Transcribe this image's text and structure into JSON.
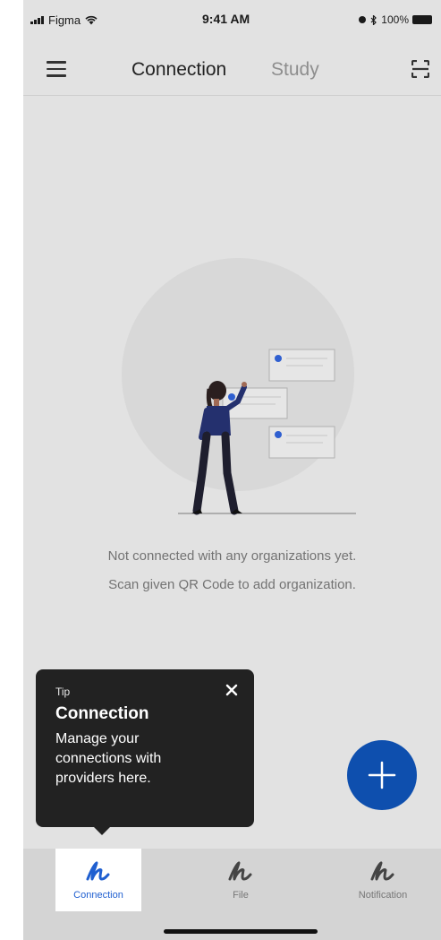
{
  "status_bar": {
    "carrier": "Figma",
    "time": "9:41 AM",
    "battery": "100%"
  },
  "top_nav": {
    "tabs": [
      {
        "label": "Connection",
        "active": true
      },
      {
        "label": "Study",
        "active": false
      }
    ],
    "menu_icon": "hamburger-icon",
    "scan_icon": "qr-scan-icon"
  },
  "empty_state": {
    "line1": "Not connected with any organizations yet.",
    "line2": "Scan given QR Code to add organization."
  },
  "tooltip": {
    "label": "Tip",
    "title": "Connection",
    "body": "Manage your connections with providers here.",
    "close_icon": "close-icon"
  },
  "fab": {
    "icon": "plus-icon",
    "color": "#0e4fae"
  },
  "bottom_nav": {
    "items": [
      {
        "label": "Connection",
        "icon": "connection-scribble-icon",
        "active": true
      },
      {
        "label": "File",
        "icon": "file-scribble-icon",
        "active": false
      },
      {
        "label": "Notification",
        "icon": "notification-scribble-icon",
        "active": false
      }
    ]
  },
  "colors": {
    "accent": "#1f5fd0",
    "tooltip_bg": "#222222",
    "overlay_bg": "#e2e2e2"
  }
}
